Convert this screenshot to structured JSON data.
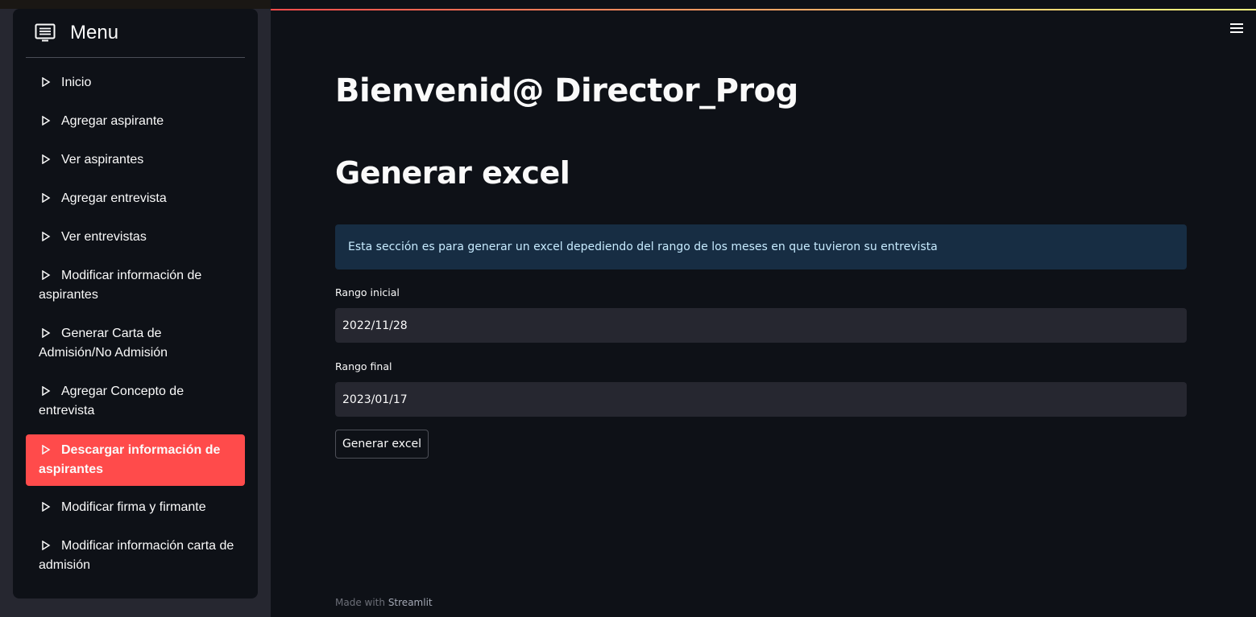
{
  "sidebar": {
    "title": "Menu",
    "header_icon": "menu-list-icon",
    "items": [
      {
        "label": "Inicio"
      },
      {
        "label": "Agregar aspirante"
      },
      {
        "label": "Ver aspirantes"
      },
      {
        "label": "Agregar entrevista"
      },
      {
        "label": "Ver entrevistas"
      },
      {
        "label": "Modificar información de aspirantes"
      },
      {
        "label": "Generar Carta de Admisión/No Admisión"
      },
      {
        "label": "Agregar Concepto de entrevista"
      },
      {
        "label": "Descargar información de aspirantes",
        "active": true
      },
      {
        "label": "Modificar firma y firmante"
      },
      {
        "label": "Modificar información carta de admisión"
      }
    ]
  },
  "main": {
    "title": "Bienvenid@ Director_Prog",
    "subtitle": "Generar excel",
    "info": "Esta sección es para generar un excel depediendo del rango de los meses en que tuvieron su entrevista",
    "start_label": "Rango inicial",
    "start_value": "2022/11/28",
    "end_label": "Rango final",
    "end_value": "2023/01/17",
    "button_label": "Generar excel"
  },
  "footer": {
    "prefix": "Made with",
    "brand": "Streamlit"
  },
  "colors": {
    "accent": "#ff4b4b",
    "background": "#0e1117",
    "sidebar": "#262730",
    "info_bg": "#172d43"
  }
}
